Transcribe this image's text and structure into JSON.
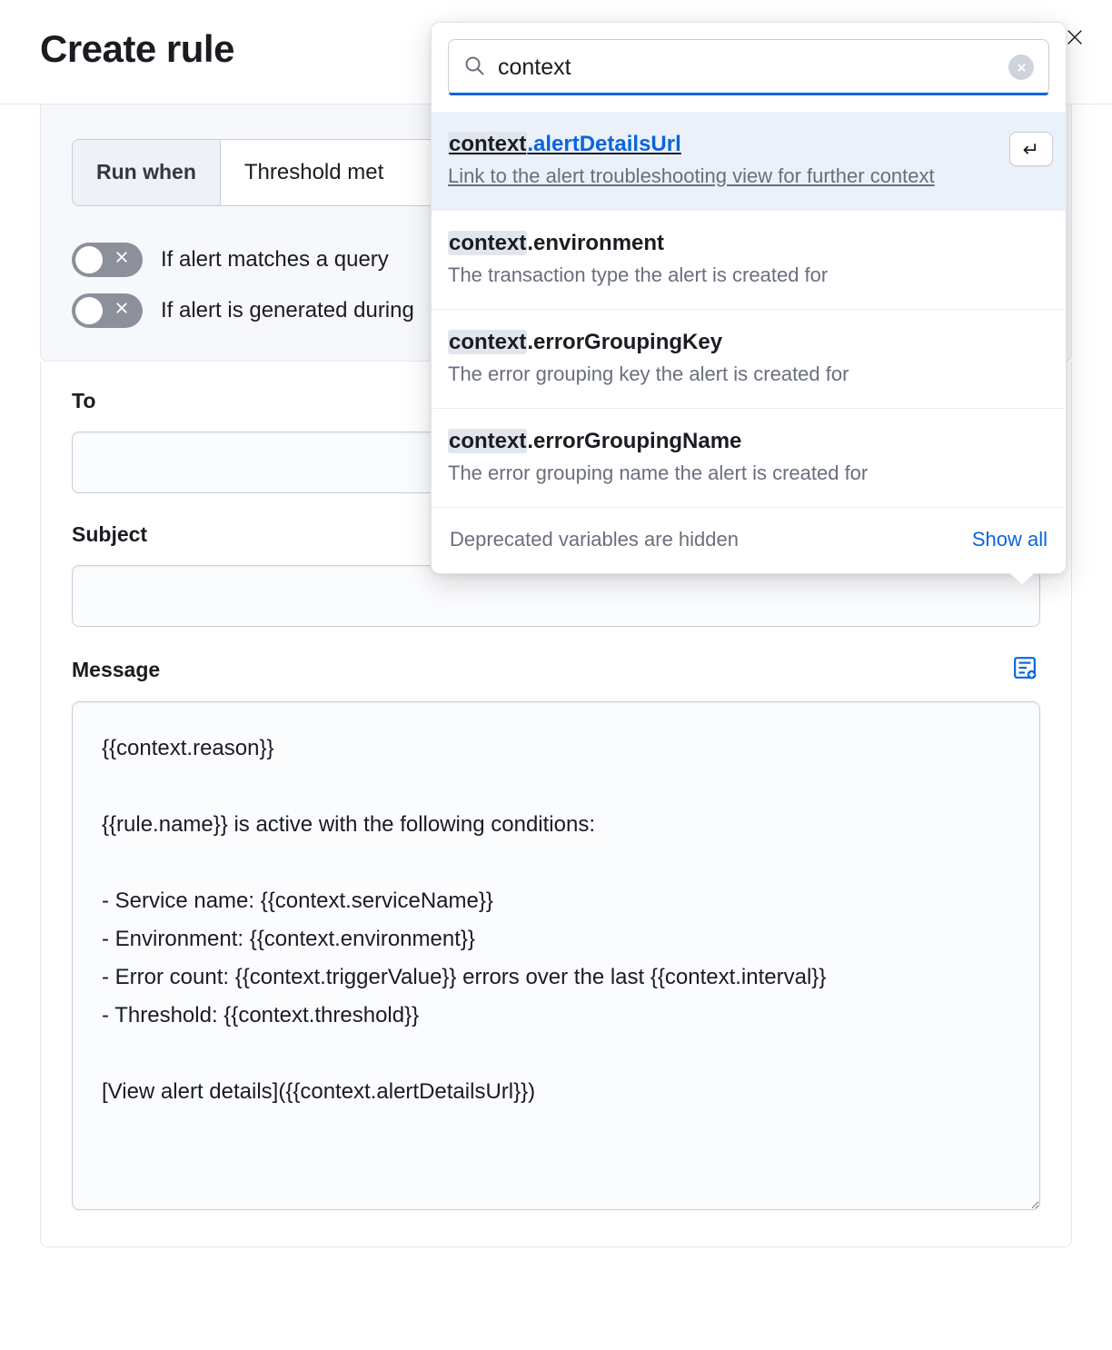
{
  "header": {
    "title": "Create rule"
  },
  "panel": {
    "runwhen_label": "Run when",
    "runwhen_value": "Threshold met",
    "toggles": [
      {
        "label": "If alert matches a query",
        "on": false
      },
      {
        "label": "If alert is generated during",
        "on": false
      }
    ]
  },
  "form": {
    "to_label": "To",
    "subject_label": "Subject",
    "message_label": "Message",
    "message_value": "{{context.reason}}\n\n{{rule.name}} is active with the following conditions:\n\n- Service name: {{context.serviceName}}\n- Environment: {{context.environment}}\n- Error count: {{context.triggerValue}} errors over the last {{context.interval}}\n- Threshold: {{context.threshold}}\n\n[View alert details]({{context.alertDetailsUrl}})"
  },
  "popover": {
    "search_value": "context",
    "suggestions": [
      {
        "match": "context",
        "rest": ".alertDetailsUrl",
        "desc": "Link to the alert troubleshooting view for further context",
        "selected": true
      },
      {
        "match": "context",
        "rest": ".environment",
        "desc": "The transaction type the alert is created for",
        "selected": false
      },
      {
        "match": "context",
        "rest": ".errorGroupingKey",
        "desc": "The error grouping key the alert is created for",
        "selected": false
      },
      {
        "match": "context",
        "rest": ".errorGroupingName",
        "desc": "The error grouping name the alert is created for",
        "selected": false
      }
    ],
    "footer_muted": "Deprecated variables are hidden",
    "footer_link": "Show all",
    "enter_glyph": "↵"
  }
}
